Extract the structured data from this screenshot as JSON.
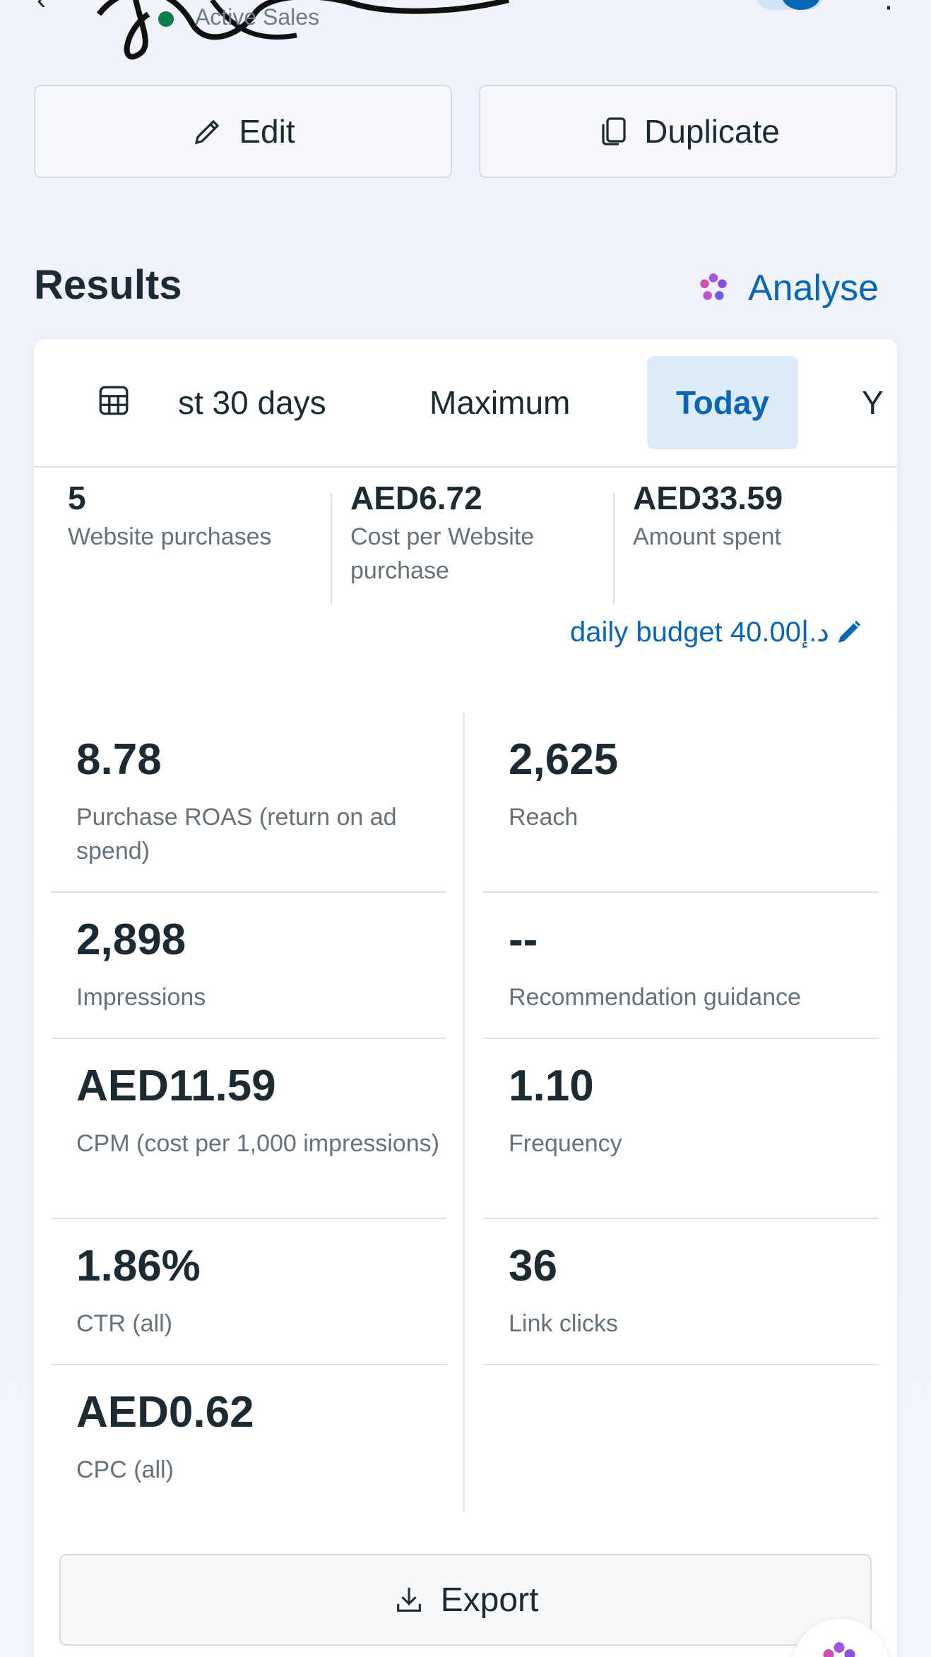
{
  "header": {
    "status": "Active Sales"
  },
  "actions": {
    "edit_label": "Edit",
    "duplicate_label": "Duplicate"
  },
  "results": {
    "title": "Results",
    "analyse_label": "Analyse"
  },
  "date_tabs": [
    "st 30 days",
    "Maximum",
    "Today",
    "Y"
  ],
  "selected_tab": "Today",
  "summary": [
    {
      "value": "5",
      "label": "Website purchases"
    },
    {
      "value": "AED6.72",
      "label": "Cost per Website purchase"
    },
    {
      "value": "AED33.59",
      "label": "Amount spent"
    }
  ],
  "budget_label": "daily budget 40.00د.إ",
  "metrics": {
    "left": [
      {
        "value": "8.78",
        "label": "Purchase ROAS (return on ad spend)"
      },
      {
        "value": "2,898",
        "label": "Impressions"
      },
      {
        "value": "AED11.59",
        "label": "CPM (cost per 1,000 impressions)"
      },
      {
        "value": "1.86%",
        "label": "CTR (all)"
      },
      {
        "value": "AED0.62",
        "label": "CPC (all)"
      }
    ],
    "right": [
      {
        "value": "2,625",
        "label": "Reach"
      },
      {
        "value": "--",
        "label": "Recommendation guidance"
      },
      {
        "value": "1.10",
        "label": "Frequency"
      },
      {
        "value": "36",
        "label": "Link clicks"
      }
    ]
  },
  "export_label": "Export",
  "colors": {
    "accent": "#0866b5",
    "text": "#1c2b33",
    "muted": "#65717b",
    "status_green": "#0a7f4c"
  }
}
